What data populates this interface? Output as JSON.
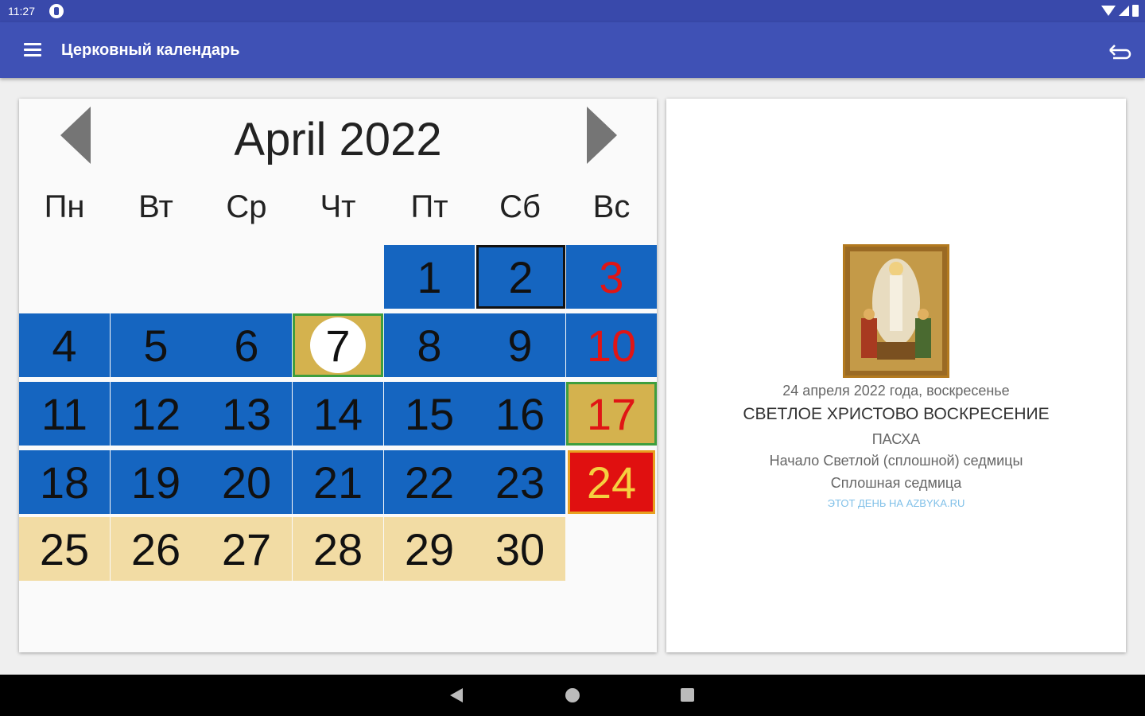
{
  "status_bar": {
    "time": "11:27"
  },
  "app_bar": {
    "title": "Церковный календарь"
  },
  "calendar": {
    "month_title": "April 2022",
    "weekdays": [
      "Пн",
      "Вт",
      "Ср",
      "Чт",
      "Пт",
      "Сб",
      "Вс"
    ],
    "days": [
      "1",
      "2",
      "3",
      "4",
      "5",
      "6",
      "7",
      "8",
      "9",
      "10",
      "11",
      "12",
      "13",
      "14",
      "15",
      "16",
      "17",
      "18",
      "19",
      "20",
      "21",
      "22",
      "23",
      "24",
      "25",
      "26",
      "27",
      "28",
      "29",
      "30"
    ],
    "colors": {
      "fasting_blue": "#1565c0",
      "bright_week_cream": "#f2dca4",
      "feast_gold": "#d4b24e",
      "selected_red": "#e01010",
      "sunday_text": "#e01515"
    }
  },
  "info": {
    "date": "24 апреля 2022 года, воскресенье",
    "feast": "СВЕТЛОЕ ХРИСТОВО ВОСКРЕСЕНИЕ",
    "pascha": "ПАСХА",
    "week_start": "Начало Светлой (сплошной) седмицы",
    "continuous": "Сплошная седмица",
    "link": "ЭТОТ ДЕНЬ НА AZBYKA.RU"
  }
}
